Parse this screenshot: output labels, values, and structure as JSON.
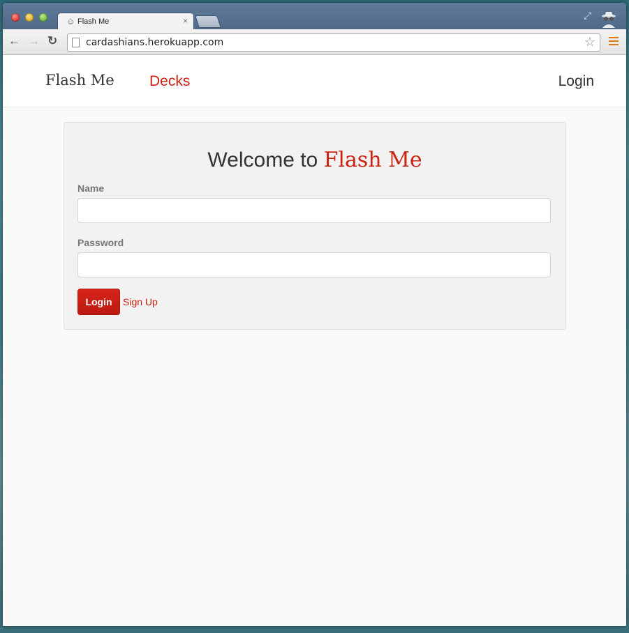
{
  "browser": {
    "tab_title": "Flash Me",
    "tab_favicon": "smiley-favicon",
    "tab_close": "×",
    "url": "cardashians.herokuapp.com",
    "icons": {
      "back": "←",
      "forward": "→",
      "reload": "↻",
      "bookmark_star": "☆",
      "expand": "⤢"
    }
  },
  "navbar": {
    "brand": "Flash Me",
    "decks_link": "Decks",
    "login_link": "Login"
  },
  "login_form": {
    "welcome_prefix": "Welcome to ",
    "welcome_brand": "Flash Me",
    "name_label": "Name",
    "name_value": "",
    "password_label": "Password",
    "password_value": "",
    "login_button": "Login",
    "signup_link": "Sign Up"
  },
  "colors": {
    "accent": "#cc2211",
    "text": "#333333",
    "label": "#777777",
    "page_bg": "#fafafa",
    "card_bg": "#f2f2f2"
  }
}
